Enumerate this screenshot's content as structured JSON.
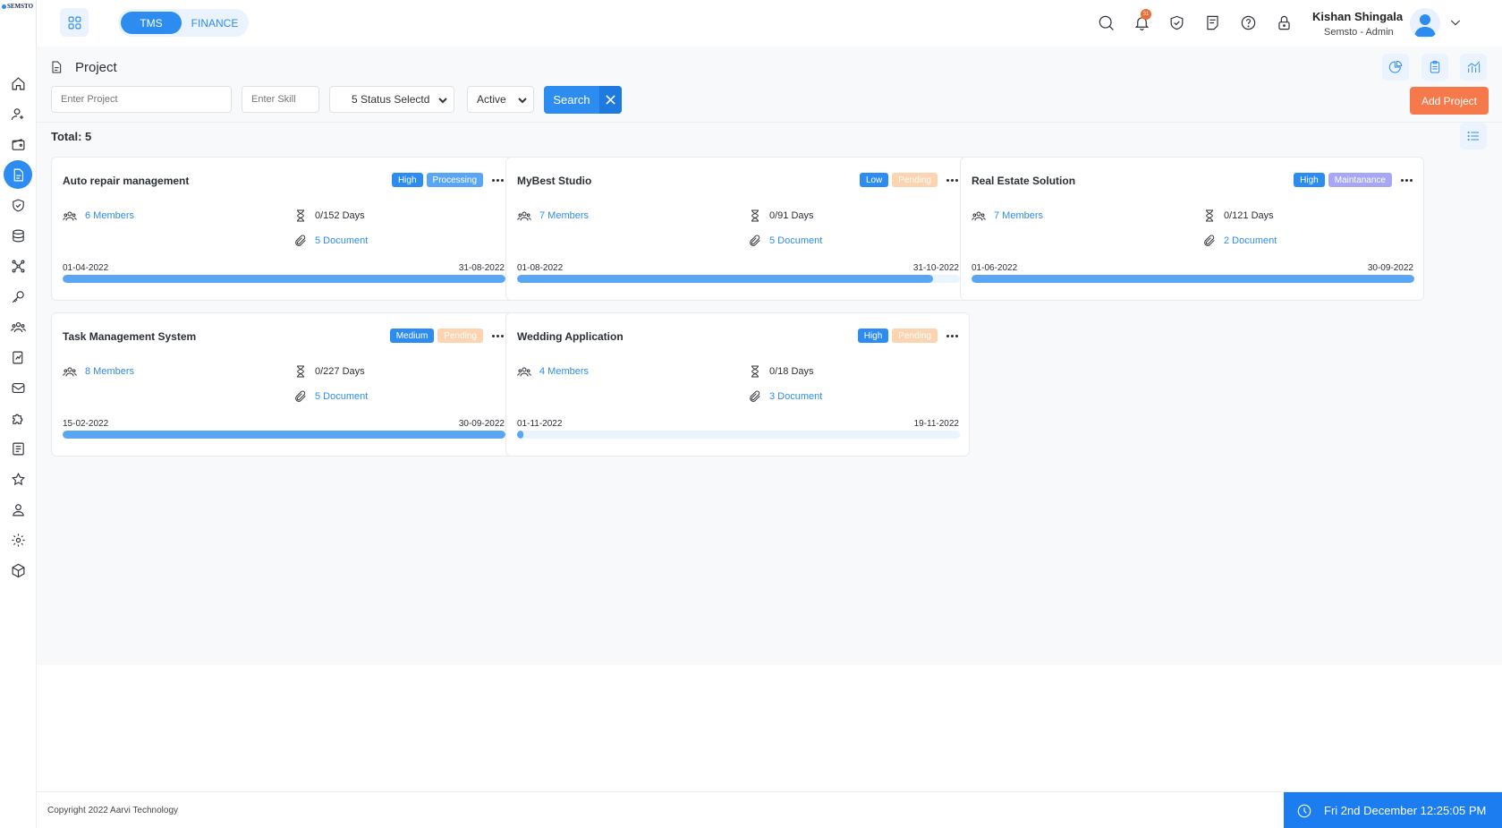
{
  "brand": {
    "logo_text": "SEMSTO"
  },
  "sidebar": {
    "items": [
      {
        "name": "home-icon"
      },
      {
        "name": "user-add-icon"
      },
      {
        "name": "wallet-icon"
      },
      {
        "name": "document-icon",
        "active": true
      },
      {
        "name": "shield-check-icon"
      },
      {
        "name": "database-icon"
      },
      {
        "name": "network-icon"
      },
      {
        "name": "key-icon"
      },
      {
        "name": "team-icon"
      },
      {
        "name": "chart-file-icon"
      },
      {
        "name": "mail-icon"
      },
      {
        "name": "puzzle-icon"
      },
      {
        "name": "list-file-icon"
      },
      {
        "name": "star-icon"
      },
      {
        "name": "person-icon"
      },
      {
        "name": "settings-icon"
      },
      {
        "name": "box-icon"
      }
    ]
  },
  "header": {
    "modules": {
      "tms": "TMS",
      "finance": "FINANCE"
    },
    "notification_count": "31",
    "user_name": "Kishan Shingala",
    "user_role": "Semsto - Admin"
  },
  "page": {
    "title": "Project",
    "filters": {
      "project_placeholder": "Enter Project",
      "skill_placeholder": "Enter Skill",
      "status_selected": "5 Status Selectd",
      "active_selected": "Active",
      "search_label": "Search"
    },
    "add_label": "Add Project",
    "total": "Total: 5"
  },
  "colors": {
    "primary": "#2d8cf0",
    "high": "#2d8cf0",
    "processing": "#5aa6f5",
    "low": "#2d8cf0",
    "pending": "#fdd3b0",
    "maintenance": "#a8a7f5",
    "medium": "#2d8cf0",
    "add_button": "#f5794a"
  },
  "projects": [
    {
      "title": "Auto repair management",
      "priority": "High",
      "status": "Processing",
      "members": "6 Members",
      "days": "0/152 Days",
      "documents": "5 Document",
      "start": "01-04-2022",
      "end": "31-08-2022",
      "progress": 1.0,
      "status_color": "#5aa6f5"
    },
    {
      "title": "MyBest Studio",
      "priority": "Low",
      "status": "Pending",
      "members": "7 Members",
      "days": "0/91 Days",
      "documents": "5 Document",
      "start": "01-08-2022",
      "end": "31-10-2022",
      "progress": 0.94,
      "status_color": "#fdd3b0"
    },
    {
      "title": "Real Estate Solution",
      "priority": "High",
      "status": "Maintanance",
      "members": "7 Members",
      "days": "0/121 Days",
      "documents": "2 Document",
      "start": "01-06-2022",
      "end": "30-09-2022",
      "progress": 1.0,
      "status_color": "#a8a7f5"
    },
    {
      "title": "Task Management System",
      "priority": "Medium",
      "status": "Pending",
      "members": "8 Members",
      "days": "0/227 Days",
      "documents": "5 Document",
      "start": "15-02-2022",
      "end": "30-09-2022",
      "progress": 1.0,
      "status_color": "#fdd3b0"
    },
    {
      "title": "Wedding Application",
      "priority": "High",
      "status": "Pending",
      "members": "4 Members",
      "days": "0/18 Days",
      "documents": "3 Document",
      "start": "01-11-2022",
      "end": "19-11-2022",
      "progress": 0.015,
      "status_color": "#fdd3b0"
    }
  ],
  "footer": {
    "copyright": "Copyright 2022 Aarvi Technology",
    "datetime": "Fri 2nd December 12:25:05 PM"
  }
}
